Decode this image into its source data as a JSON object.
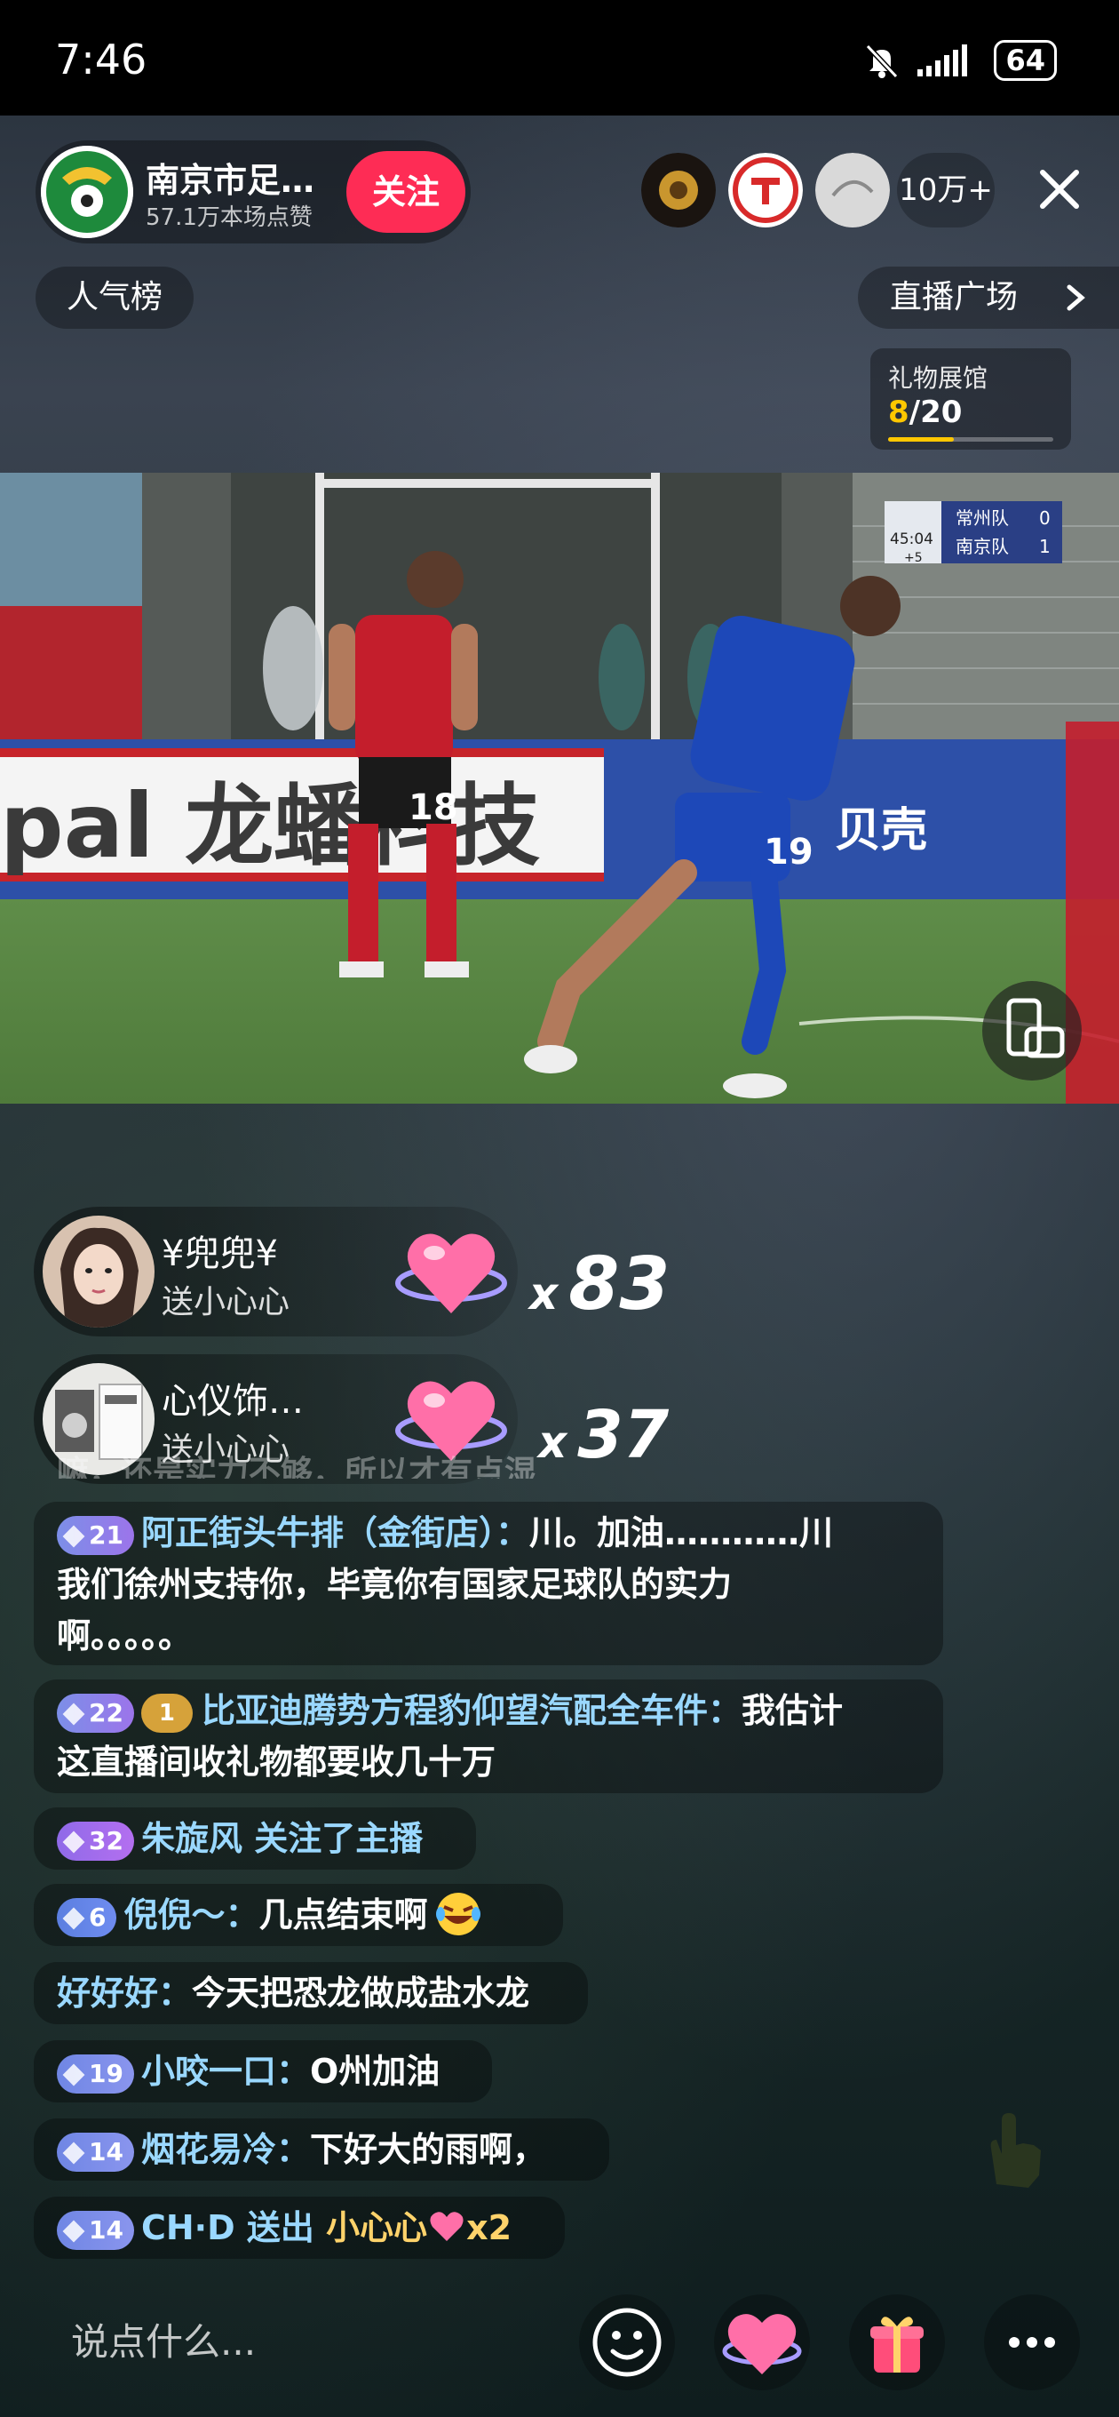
{
  "status_bar": {
    "time": "7:46",
    "battery": "64"
  },
  "host": {
    "name": "南京市足…",
    "subtitle": "57.1万本场点赞",
    "follow_label": "关注"
  },
  "viewers": {
    "count": "10万+"
  },
  "top_pills": {
    "rank_label": "人气榜",
    "plaza_label": "直播广场"
  },
  "gift_hall": {
    "title": "礼物展馆",
    "current": "8",
    "total": "/20",
    "progress": 0.4
  },
  "scoreboard": {
    "time": "45:04",
    "extra": "+5",
    "home": {
      "name": "常州队",
      "score": "0"
    },
    "away": {
      "name": "南京队",
      "score": "1"
    }
  },
  "video_signs": {
    "board_left": "pal 龙蟠科技",
    "board_right": "贝壳",
    "jersey_red": "18",
    "jersey_blue": "19"
  },
  "gift_banners": [
    {
      "user": "¥兜兜¥",
      "action": "送小心心",
      "x": "x",
      "count": "83"
    },
    {
      "user": "心仪饰…",
      "action": "送小心心",
      "x": "x",
      "count": "37"
    }
  ],
  "faded_message": "嘛，还是实力不够，所以才有点湿",
  "chat": [
    {
      "level": "21",
      "user": "阿正街头牛排（金街店）：",
      "line1": "川。加油…………川",
      "line2": "我们徐州支持你，毕竟你有国家足球队的实力",
      "line3": "啊。。。。。"
    },
    {
      "level": "22",
      "badge": "1",
      "user": "比亚迪腾势方程豹仰望汽配全车件：",
      "line1": "我估计",
      "line2": "这直播间收礼物都要收几十万"
    },
    {
      "level": "32",
      "user": "朱旋风 关注了主播"
    },
    {
      "level": "6",
      "user": "倪倪～：",
      "text": "几点结束啊"
    },
    {
      "user": "好好好：",
      "text": "今天把恐龙做成盐水龙"
    },
    {
      "level": "19",
      "user": "小咬一口：",
      "text": "O州加油"
    },
    {
      "level": "14",
      "user": "烟花易冷：",
      "text": "下好大的雨啊，"
    },
    {
      "level": "14",
      "user": "CH·D 送出",
      "gift": "小心心",
      "multiplier": "x2"
    }
  ],
  "input": {
    "placeholder": "说点什么..."
  }
}
